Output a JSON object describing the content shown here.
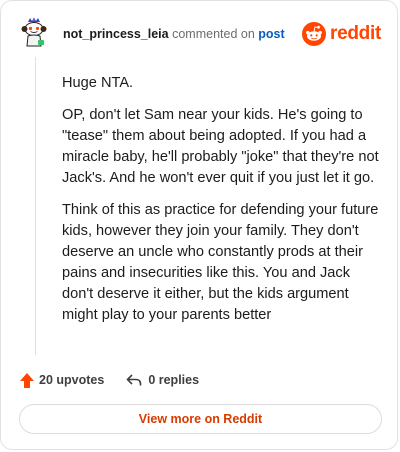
{
  "header": {
    "username": "not_princess_leia",
    "action": "commented on",
    "link": "post",
    "brand": "reddit"
  },
  "comment": {
    "paragraphs": [
      "Huge NTA.",
      "OP, don't let Sam near your kids. He's going to \"tease\" them about being adopted. If you had a miracle baby, he'll probably \"joke\" that they're not Jack's. And he won't ever quit if you just let it go.",
      "Think of this as practice for defending your future kids, however they join your family. They don't deserve an uncle who constantly prods at their pains and insecurities like this. You and Jack don't deserve it either, but the kids argument might play to your parents better"
    ]
  },
  "footer": {
    "upvotes": "20 upvotes",
    "replies": "0 replies"
  },
  "cta": {
    "label": "View more on Reddit"
  },
  "colors": {
    "brand": "#ff4500",
    "link": "#0a5cc2",
    "upvote": "#ff4500",
    "cta_text": "#d93a00"
  }
}
